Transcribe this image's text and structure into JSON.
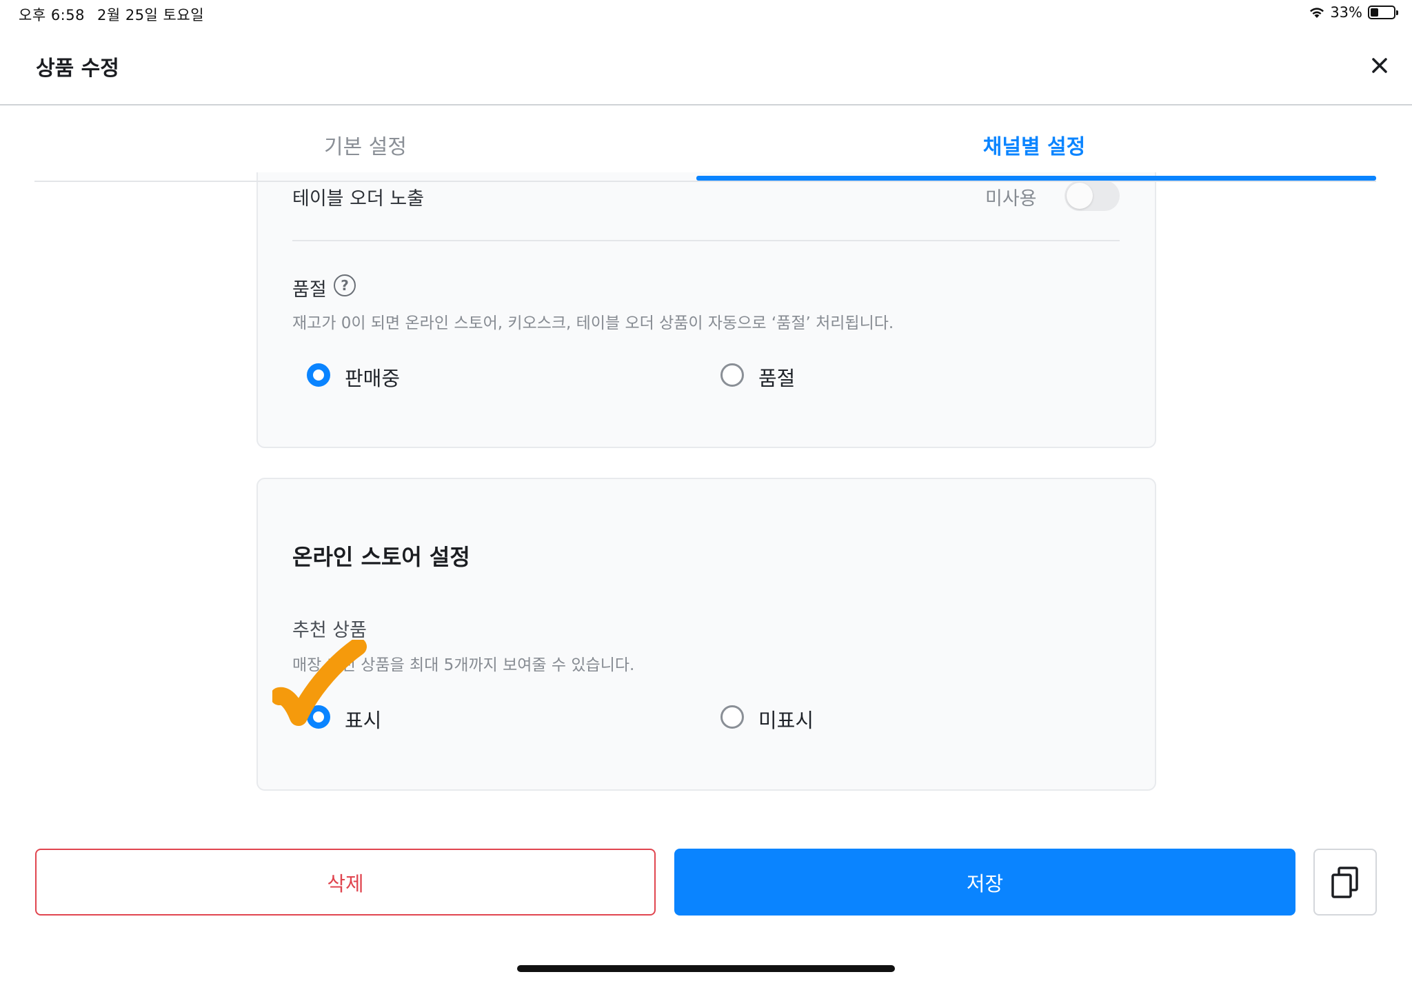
{
  "status_bar": {
    "time": "오후 6:58",
    "date": "2월 25일 토요일",
    "battery": "33%",
    "battery_level": 0.33
  },
  "header": {
    "title": "상품 수정",
    "close_icon": "close-icon"
  },
  "tabs": [
    {
      "label": "기본 설정",
      "active": false
    },
    {
      "label": "채널별 설정",
      "active": true
    }
  ],
  "table_order": {
    "label": "테이블 오더 노출",
    "toggle_status": "미사용",
    "toggle_on": false
  },
  "sold_out": {
    "title": "품절",
    "help_icon": "question-circle-icon",
    "help_glyph": "?",
    "description": "재고가 0이 되면 온라인 스토어, 키오스크, 테이블 오더 상품이 자동으로 ‘품절’ 처리됩니다.",
    "options": [
      "판매중",
      "품절"
    ],
    "selected": "판매중"
  },
  "online_store": {
    "section_title": "온라인 스토어 설정",
    "recommended": {
      "title": "추천 상품",
      "description": "매장 추천 상품을 최대 5개까지 보여줄 수 있습니다.",
      "options": [
        "표시",
        "미표시"
      ],
      "selected": "표시"
    }
  },
  "footer": {
    "delete_label": "삭제",
    "save_label": "저장",
    "copy_icon": "copy-icon"
  },
  "annotation": {
    "icon": "orange-checkmark-icon",
    "color": "#f59a0c"
  },
  "colors": {
    "accent": "#0a84ff",
    "danger": "#e0454f"
  }
}
